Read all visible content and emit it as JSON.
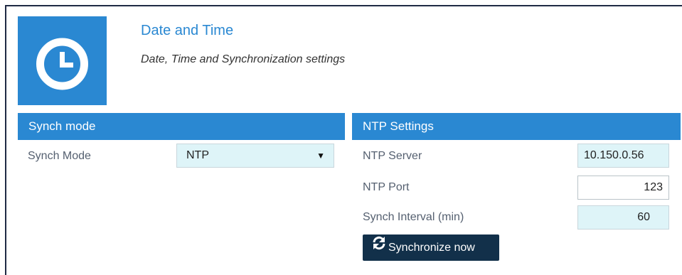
{
  "header": {
    "title": "Date and Time",
    "subtitle": "Date, Time and Synchronization settings",
    "icon": "clock-icon",
    "icon_bg": "#2a88d2"
  },
  "synch_panel": {
    "title": "Synch mode",
    "mode_label": "Synch Mode",
    "mode_value": "NTP"
  },
  "ntp_panel": {
    "title": "NTP Settings",
    "server_label": "NTP Server",
    "server_value": "10.150.0.56",
    "port_label": "NTP Port",
    "port_value": "123",
    "interval_label": "Synch Interval (min)",
    "interval_value": "60",
    "sync_button": "Synchronize now",
    "sync_icon": "refresh-icon"
  },
  "colors": {
    "accent": "#2a88d2",
    "button_bg": "#12304a",
    "field_bg": "#def4f8"
  }
}
